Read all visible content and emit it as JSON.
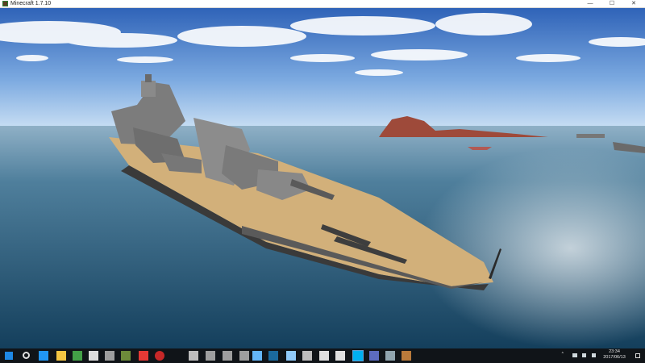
{
  "window": {
    "title": "Minecraft 1.7.10",
    "controls": {
      "minimize": "—",
      "maximize": "☐",
      "close": "✕"
    }
  },
  "scene": {
    "description_icon": "minecraft-battleship-scene"
  },
  "taskbar": {
    "items": [
      {
        "name": "start-icon",
        "color": "#1e88e5"
      },
      {
        "name": "search-icon",
        "color": "#e0e0e0"
      },
      {
        "name": "edge-icon",
        "color": "#2196f3"
      },
      {
        "name": "file-explorer-icon",
        "color": "#f4c542"
      },
      {
        "name": "app-green-icon",
        "color": "#43a047"
      },
      {
        "name": "app-white-icon",
        "color": "#dddddd"
      },
      {
        "name": "tank-icon",
        "color": "#9e9e9e"
      },
      {
        "name": "minecraft-icon",
        "color": "#6d8b3a"
      },
      {
        "name": "red-app-icon",
        "color": "#e53935"
      },
      {
        "name": "record-icon",
        "color": "#c62828"
      },
      {
        "name": "film-icon",
        "color": "#bdbdbd"
      },
      {
        "name": "tank-2-icon",
        "color": "#9e9e9e"
      },
      {
        "name": "tank-3-icon",
        "color": "#9e9e9e"
      },
      {
        "name": "tank-4-icon",
        "color": "#9e9e9e"
      },
      {
        "name": "app-blue-icon",
        "color": "#64b5f6"
      },
      {
        "name": "steam-icon",
        "color": "#1b6a9e"
      },
      {
        "name": "app-pen-icon",
        "color": "#90caf9"
      },
      {
        "name": "warship-icon",
        "color": "#bdbdbd"
      },
      {
        "name": "calculator-icon",
        "color": "#e0e0e0"
      },
      {
        "name": "app-ring-icon",
        "color": "#e0e0e0"
      },
      {
        "name": "skype-icon",
        "color": "#00aff0"
      },
      {
        "name": "window-icon",
        "color": "#5c6bc0"
      },
      {
        "name": "app-box-icon",
        "color": "#90a4ae"
      },
      {
        "name": "java-icon",
        "color": "#b97a3b"
      }
    ],
    "tray": {
      "icons": [
        "chevron-up-icon",
        "network-icon",
        "volume-icon",
        "ime-icon"
      ],
      "time": "23:34",
      "date": "2017/06/13",
      "notification_icon": "notification-icon"
    }
  }
}
